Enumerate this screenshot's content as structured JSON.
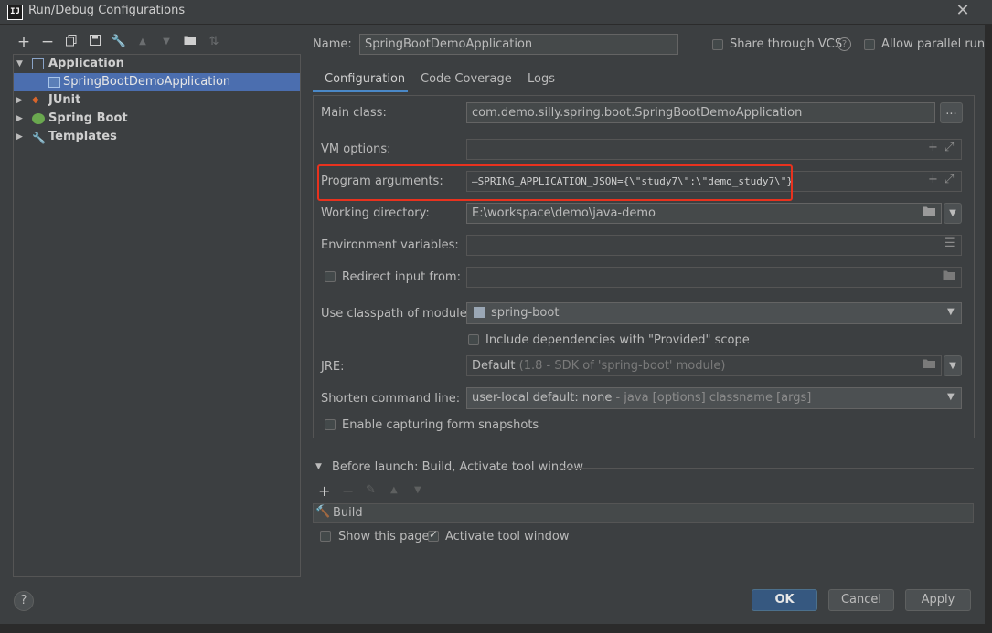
{
  "window": {
    "title": "Run/Debug Configurations",
    "logo_text": "IJ"
  },
  "toolbar": {
    "icons": [
      "add-icon",
      "remove-icon",
      "copy-icon",
      "save-icon",
      "wrench-icon",
      "move-up-icon",
      "move-down-icon",
      "folder-add-icon",
      "sort-icon"
    ]
  },
  "tree": {
    "items": [
      {
        "label": "Application",
        "expanded": true,
        "icon": "application-icon"
      },
      {
        "label": "SpringBootDemoApplication",
        "selected": true,
        "icon": "application-config-icon"
      },
      {
        "label": "JUnit",
        "expanded": false,
        "icon": "junit-icon"
      },
      {
        "label": "Spring Boot",
        "expanded": false,
        "icon": "spring-boot-icon"
      },
      {
        "label": "Templates",
        "expanded": false,
        "icon": "wrench-icon"
      }
    ]
  },
  "header": {
    "name_label": "Name:",
    "name_value": "SpringBootDemoApplication",
    "share_label": "Share through VCS",
    "parallel_label": "Allow parallel run"
  },
  "tabs": [
    {
      "label": "Configuration",
      "active": true
    },
    {
      "label": "Code Coverage",
      "active": false
    },
    {
      "label": "Logs",
      "active": false
    }
  ],
  "form": {
    "main_class_label": "Main class:",
    "main_class_value": "com.demo.silly.spring.boot.SpringBootDemoApplication",
    "browse_label": "...",
    "vm_options_label": "VM options:",
    "vm_options_value": "",
    "program_args_label": "Program arguments:",
    "program_args_value": "—SPRING_APPLICATION_JSON={\\\"study7\\\":\\\"demo_study7\\\"}",
    "working_dir_label": "Working directory:",
    "working_dir_value": "E:\\workspace\\demo\\java-demo",
    "env_vars_label": "Environment variables:",
    "env_vars_value": "",
    "redirect_label": "Redirect input from:",
    "redirect_value": "",
    "classpath_label": "Use classpath of module:",
    "classpath_value": "spring-boot",
    "include_deps_label": "Include dependencies with \"Provided\" scope",
    "jre_label": "JRE:",
    "jre_value": "Default",
    "jre_hint": "(1.8 - SDK of 'spring-boot' module)",
    "shorten_label": "Shorten command line:",
    "shorten_value": "user-local default: none",
    "shorten_hint": "- java [options] classname [args]",
    "snapshots_label": "Enable capturing form snapshots"
  },
  "before_launch": {
    "title": "Before launch: Build, Activate tool window",
    "build_label": "Build",
    "show_page_label": "Show this page",
    "activate_label": "Activate tool window"
  },
  "buttons": {
    "ok": "OK",
    "cancel": "Cancel",
    "apply": "Apply",
    "help": "?"
  },
  "colors": {
    "accent": "#4a88c7",
    "selection": "#4b6eaf",
    "highlight_box": "#e8321e",
    "primary_button": "#365880"
  }
}
